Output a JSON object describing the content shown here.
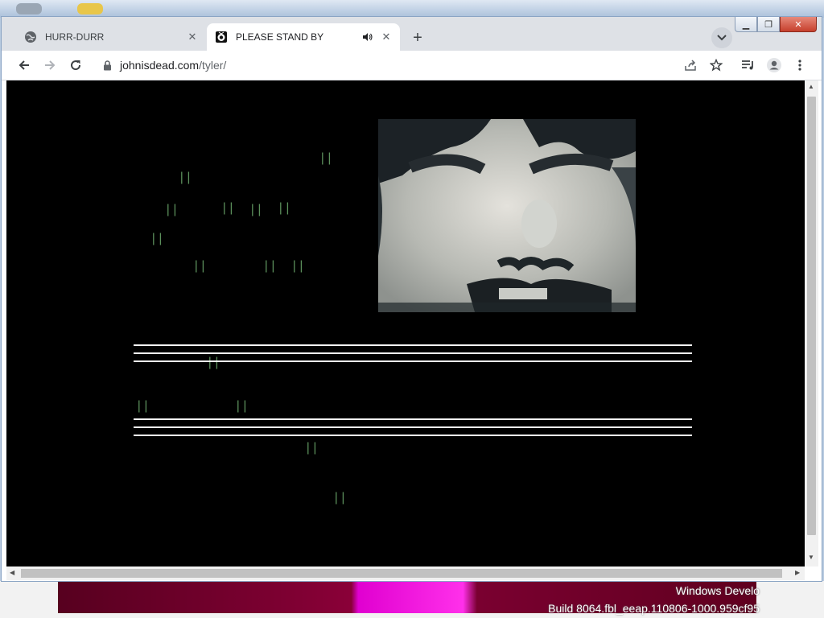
{
  "tabs": [
    {
      "title": "HURR-DURR",
      "icon": "globe-icon",
      "active": false
    },
    {
      "title": "PLEASE STAND BY",
      "icon": "tv-icon",
      "active": true,
      "audio": true
    }
  ],
  "toolbar": {
    "url_domain": "johnisdead.com",
    "url_path": "/tyler/"
  },
  "page": {
    "background": "#000000",
    "glyph_text": "||",
    "glyph_color": "#5b8f5b"
  },
  "desktop": {
    "watermark_line1": "Windows Develo",
    "watermark_line2": "Build 8064.fbl_eeap.110806-1000.959cf95"
  }
}
